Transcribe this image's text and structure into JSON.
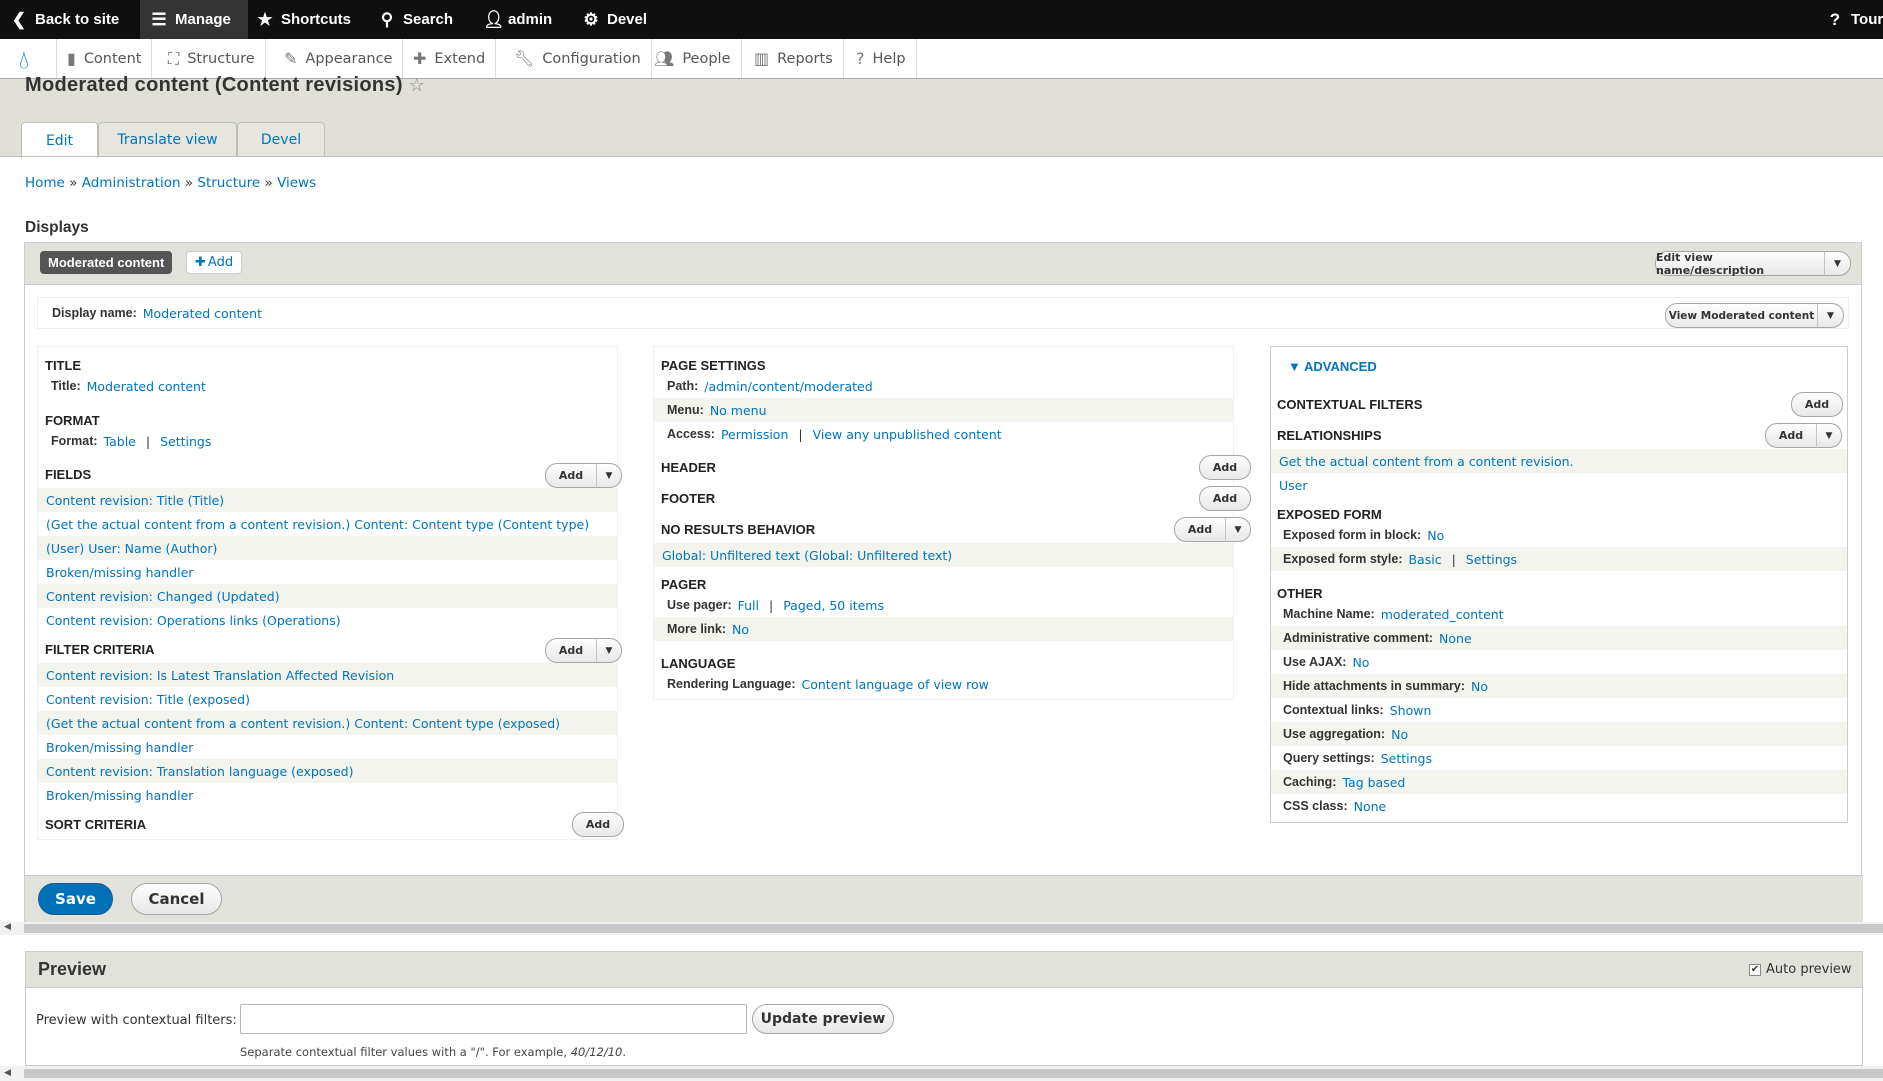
{
  "toolbar": {
    "back": "Back to site",
    "manage": "Manage",
    "shortcuts": "Shortcuts",
    "search": "Search",
    "user": "admin",
    "devel": "Devel",
    "tour": "Tour"
  },
  "tray": {
    "items": [
      "Content",
      "Structure",
      "Appearance",
      "Extend",
      "Configuration",
      "People",
      "Reports",
      "Help"
    ]
  },
  "page": {
    "title": "Moderated content (Content revisions)",
    "tabs": [
      "Edit",
      "Translate view",
      "Devel"
    ],
    "breadcrumb": [
      "Home",
      "Administration",
      "Structure",
      "Views"
    ],
    "breadcrumb_sep": "»",
    "displays_heading": "Displays"
  },
  "display": {
    "tab": "Moderated content",
    "add": "Add",
    "edit_name": "Edit view name/description",
    "name_label": "Display name:",
    "name_value": "Moderated content",
    "view_btn": "View Moderated content"
  },
  "col1": {
    "title_h": "TITLE",
    "title_label": "Title:",
    "title_value": "Moderated content",
    "format_h": "FORMAT",
    "format_label": "Format:",
    "format_value": "Table",
    "format_settings": "Settings",
    "fields_h": "FIELDS",
    "add": "Add",
    "fields": [
      "Content revision: Title (Title)",
      "(Get the actual content from a content revision.) Content: Content type (Content type)",
      "(User) User: Name (Author)",
      "Broken/missing handler",
      "Content revision: Changed (Updated)",
      "Content revision: Operations links (Operations)"
    ],
    "filters_h": "FILTER CRITERIA",
    "filters": [
      "Content revision: Is Latest Translation Affected Revision",
      "Content revision: Title (exposed)",
      "(Get the actual content from a content revision.) Content: Content type (exposed)",
      "Broken/missing handler",
      "Content revision: Translation language (exposed)",
      "Broken/missing handler"
    ],
    "sort_h": "SORT CRITERIA"
  },
  "col2": {
    "page_h": "PAGE SETTINGS",
    "path_label": "Path:",
    "path_value": "/admin/content/moderated",
    "menu_label": "Menu:",
    "menu_value": "No menu",
    "access_label": "Access:",
    "access_value": "Permission",
    "access_value2": "View any unpublished content",
    "header_h": "HEADER",
    "footer_h": "FOOTER",
    "nores_h": "NO RESULTS BEHAVIOR",
    "nores_item": "Global: Unfiltered text (Global: Unfiltered text)",
    "pager_h": "PAGER",
    "pager_label": "Use pager:",
    "pager_value": "Full",
    "pager_value2": "Paged, 50 items",
    "more_label": "More link:",
    "more_value": "No",
    "lang_h": "LANGUAGE",
    "lang_label": "Rendering Language:",
    "lang_value": "Content language of view row"
  },
  "col3": {
    "adv": "ADVANCED",
    "ctx_h": "CONTEXTUAL FILTERS",
    "rel_h": "RELATIONSHIPS",
    "rel_items": [
      "Get the actual content from a content revision.",
      "User"
    ],
    "exp_h": "EXPOSED FORM",
    "exp_block_label": "Exposed form in block:",
    "exp_block_value": "No",
    "exp_style_label": "Exposed form style:",
    "exp_style_value": "Basic",
    "exp_style_settings": "Settings",
    "other_h": "OTHER",
    "other": [
      {
        "label": "Machine Name:",
        "value": "moderated_content"
      },
      {
        "label": "Administrative comment:",
        "value": "None"
      },
      {
        "label": "Use AJAX:",
        "value": "No"
      },
      {
        "label": "Hide attachments in summary:",
        "value": "No"
      },
      {
        "label": "Contextual links:",
        "value": "Shown"
      },
      {
        "label": "Use aggregation:",
        "value": "No"
      },
      {
        "label": "Query settings:",
        "value": "Settings"
      },
      {
        "label": "Caching:",
        "value": "Tag based"
      },
      {
        "label": "CSS class:",
        "value": "None"
      }
    ]
  },
  "actions": {
    "save": "Save",
    "cancel": "Cancel"
  },
  "preview": {
    "heading": "Preview",
    "auto": "Auto preview",
    "ctx_label": "Preview with contextual filters:",
    "ctx_value": "",
    "update": "Update preview",
    "help_prefix": "Separate contextual filter values with a \"/\". For example,",
    "help_example": "40/12/10",
    "help_suffix": "."
  },
  "colors": {
    "link": "#0074bd",
    "toolbar": "#0f0f0f",
    "primary": "#0074bd",
    "header_bg": "#e0e0d8"
  }
}
